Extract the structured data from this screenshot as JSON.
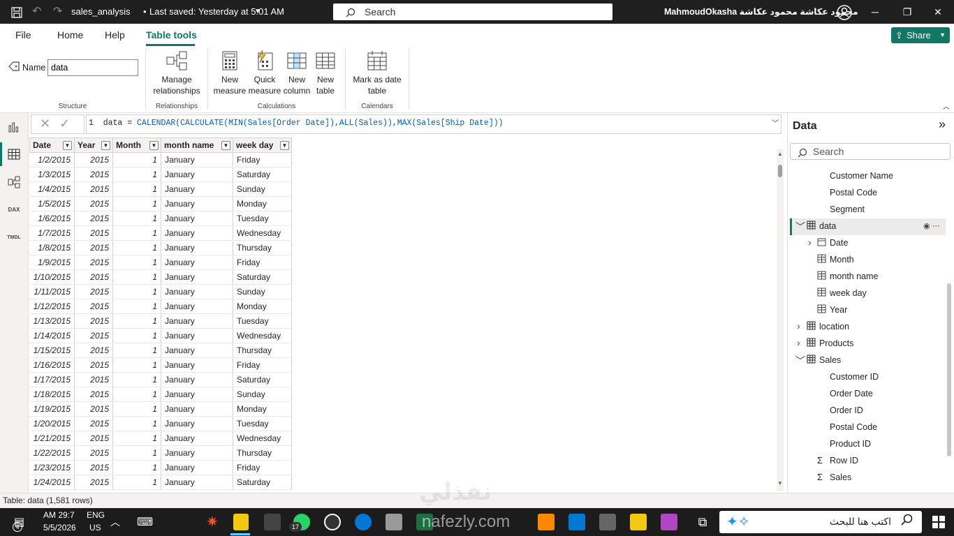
{
  "titlebar": {
    "file_title": "sales_analysis",
    "saved_status": "Last saved: Yesterday at 5:01 AM",
    "search_placeholder": "Search",
    "user_name": "MahmoudOkasha محمود عكاشة محمود عكاشة"
  },
  "menu": {
    "file": "File",
    "home": "Home",
    "help": "Help",
    "table_tools": "Table tools",
    "share": "Share"
  },
  "ribbon": {
    "name_label": "Name",
    "name_value": "data",
    "structure_label": "Structure",
    "manage_relationships": [
      "Manage",
      "relationships"
    ],
    "relationships_label": "Relationships",
    "new_measure": [
      "New",
      "measure"
    ],
    "quick_measure": [
      "Quick",
      "measure"
    ],
    "new_column": [
      "New",
      "column"
    ],
    "new_table": [
      "New",
      "table"
    ],
    "calculations_label": "Calculations",
    "mark_as_date": [
      "Mark as date",
      "table"
    ],
    "calendars_label": "Calendars"
  },
  "formula": {
    "line_no": "1",
    "prefix": "data = ",
    "expr": "CALENDAR(CALCULATE(MIN(Sales[Order Date]),ALL(Sales)),MAX(Sales[Ship Date]))"
  },
  "grid": {
    "columns": [
      "Date",
      "Year",
      "Month",
      "month name",
      "week day"
    ],
    "rows": [
      [
        "1/2/2015",
        "2015",
        "1",
        "January",
        "Friday"
      ],
      [
        "1/3/2015",
        "2015",
        "1",
        "January",
        "Saturday"
      ],
      [
        "1/4/2015",
        "2015",
        "1",
        "January",
        "Sunday"
      ],
      [
        "1/5/2015",
        "2015",
        "1",
        "January",
        "Monday"
      ],
      [
        "1/6/2015",
        "2015",
        "1",
        "January",
        "Tuesday"
      ],
      [
        "1/7/2015",
        "2015",
        "1",
        "January",
        "Wednesday"
      ],
      [
        "1/8/2015",
        "2015",
        "1",
        "January",
        "Thursday"
      ],
      [
        "1/9/2015",
        "2015",
        "1",
        "January",
        "Friday"
      ],
      [
        "1/10/2015",
        "2015",
        "1",
        "January",
        "Saturday"
      ],
      [
        "1/11/2015",
        "2015",
        "1",
        "January",
        "Sunday"
      ],
      [
        "1/12/2015",
        "2015",
        "1",
        "January",
        "Monday"
      ],
      [
        "1/13/2015",
        "2015",
        "1",
        "January",
        "Tuesday"
      ],
      [
        "1/14/2015",
        "2015",
        "1",
        "January",
        "Wednesday"
      ],
      [
        "1/15/2015",
        "2015",
        "1",
        "January",
        "Thursday"
      ],
      [
        "1/16/2015",
        "2015",
        "1",
        "January",
        "Friday"
      ],
      [
        "1/17/2015",
        "2015",
        "1",
        "January",
        "Saturday"
      ],
      [
        "1/18/2015",
        "2015",
        "1",
        "January",
        "Sunday"
      ],
      [
        "1/19/2015",
        "2015",
        "1",
        "January",
        "Monday"
      ],
      [
        "1/20/2015",
        "2015",
        "1",
        "January",
        "Tuesday"
      ],
      [
        "1/21/2015",
        "2015",
        "1",
        "January",
        "Wednesday"
      ],
      [
        "1/22/2015",
        "2015",
        "1",
        "January",
        "Thursday"
      ],
      [
        "1/23/2015",
        "2015",
        "1",
        "January",
        "Friday"
      ],
      [
        "1/24/2015",
        "2015",
        "1",
        "January",
        "Saturday"
      ]
    ]
  },
  "data_pane": {
    "title": "Data",
    "search_placeholder": "Search",
    "customer_fields": [
      "Customer Name",
      "Postal Code",
      "Segment"
    ],
    "data_table": "data",
    "data_fields": [
      "Date",
      "Month",
      "month name",
      "week day",
      "Year"
    ],
    "other_tables": [
      "location",
      "Products"
    ],
    "sales_table": "Sales",
    "sales_fields": [
      "Customer ID",
      "Order Date",
      "Order ID",
      "Postal Code",
      "Product ID",
      "Row ID",
      "Sales"
    ]
  },
  "status": "Table: data (1,581 rows)",
  "taskbar": {
    "time": "AM 29:7",
    "date": "5/5/2026",
    "lang": "ENG",
    "lang2": "US",
    "notif": "4",
    "badge": "17",
    "search_text": "اكتب هنا للبحث"
  },
  "watermark": "نفذلي",
  "watermark2": "nafezly.com",
  "accent_color": "#117865"
}
